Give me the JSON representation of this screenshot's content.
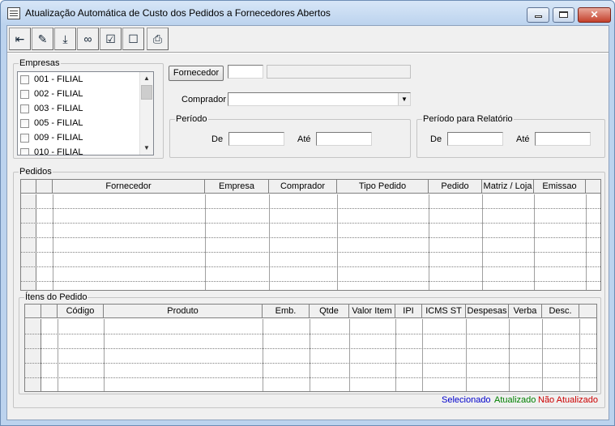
{
  "window": {
    "title": "Atualização Automática de Custo dos Pedidos a Fornecedores Abertos",
    "close_glyph": "✕"
  },
  "toolbar": [
    {
      "name": "exit-icon",
      "glyph": "⇤"
    },
    {
      "name": "pencil-icon",
      "glyph": "✎"
    },
    {
      "name": "save-download-icon",
      "glyph": "⤓"
    },
    {
      "name": "binoculars-icon",
      "glyph": "∞"
    },
    {
      "name": "check-all-icon",
      "glyph": "☑"
    },
    {
      "name": "uncheck-all-icon",
      "glyph": "☐"
    },
    {
      "name": "printer-icon",
      "glyph": "⎙"
    }
  ],
  "empresas": {
    "title": "Empresas",
    "items": [
      "001 - FILIAL",
      "002 - FILIAL",
      "003 - FILIAL",
      "005 - FILIAL",
      "009 - FILIAL",
      "010 - FILIAL"
    ]
  },
  "filters": {
    "fornecedor_button": "Fornecedor",
    "fornecedor_code": "",
    "fornecedor_name": "",
    "comprador_label": "Comprador",
    "comprador_value": ""
  },
  "periodo": {
    "title": "Período",
    "de_label": "De",
    "ate_label": "Até",
    "de_value": "",
    "ate_value": ""
  },
  "periodo_relatorio": {
    "title": "Período para Relatório",
    "de_label": "De",
    "ate_label": "Até",
    "de_value": "",
    "ate_value": ""
  },
  "pedidos": {
    "title": "Pedidos",
    "columns": [
      "Fornecedor",
      "Empresa",
      "Comprador",
      "Tipo Pedido",
      "Pedido",
      "Matriz / Loja",
      "Emissao"
    ]
  },
  "itens": {
    "title": "Ítens do Pedido",
    "columns": [
      "Código",
      "Produto",
      "Emb.",
      "Qtde",
      "Valor Item",
      "IPI",
      "ICMS ST",
      "Despesas",
      "Verba",
      "Desc."
    ]
  },
  "legend": {
    "selecionado": "Selecionado",
    "atualizado": "Atualizado",
    "nao_atualizado": "Não Atualizado",
    "colors": {
      "selecionado": "#0000cc",
      "atualizado": "#008000",
      "nao_atualizado": "#cc0000"
    }
  }
}
